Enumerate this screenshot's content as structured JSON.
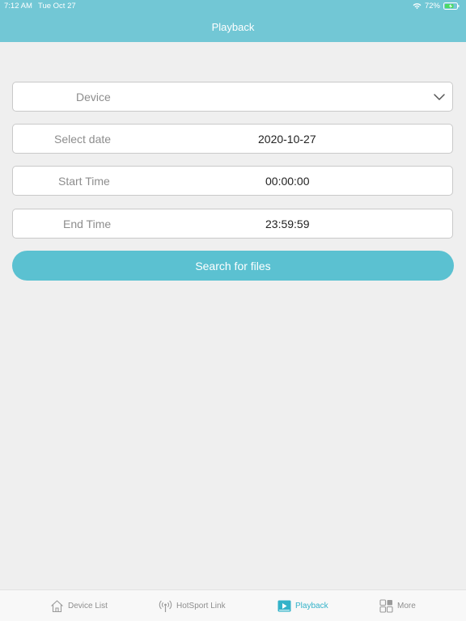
{
  "status_bar": {
    "time": "7:12 AM",
    "date": "Tue Oct 27",
    "battery": "72%"
  },
  "nav": {
    "title": "Playback"
  },
  "form": {
    "device": {
      "placeholder": "Device"
    },
    "date": {
      "label": "Select date",
      "value": "2020-10-27"
    },
    "start_time": {
      "label": "Start Time",
      "value": "00:00:00"
    },
    "end_time": {
      "label": "End Time",
      "value": "23:59:59"
    },
    "search_button": "Search for files"
  },
  "tabs": [
    {
      "label": "Device List",
      "icon": "home-icon",
      "active": false
    },
    {
      "label": "HotSport Link",
      "icon": "antenna-icon",
      "active": false
    },
    {
      "label": "Playback",
      "icon": "playback-icon",
      "active": true
    },
    {
      "label": "More",
      "icon": "grid-icon",
      "active": false
    }
  ],
  "colors": {
    "header": "#72c7d5",
    "accent": "#5bc1d1",
    "active_tab": "#33b2c9",
    "background": "#efefef"
  }
}
